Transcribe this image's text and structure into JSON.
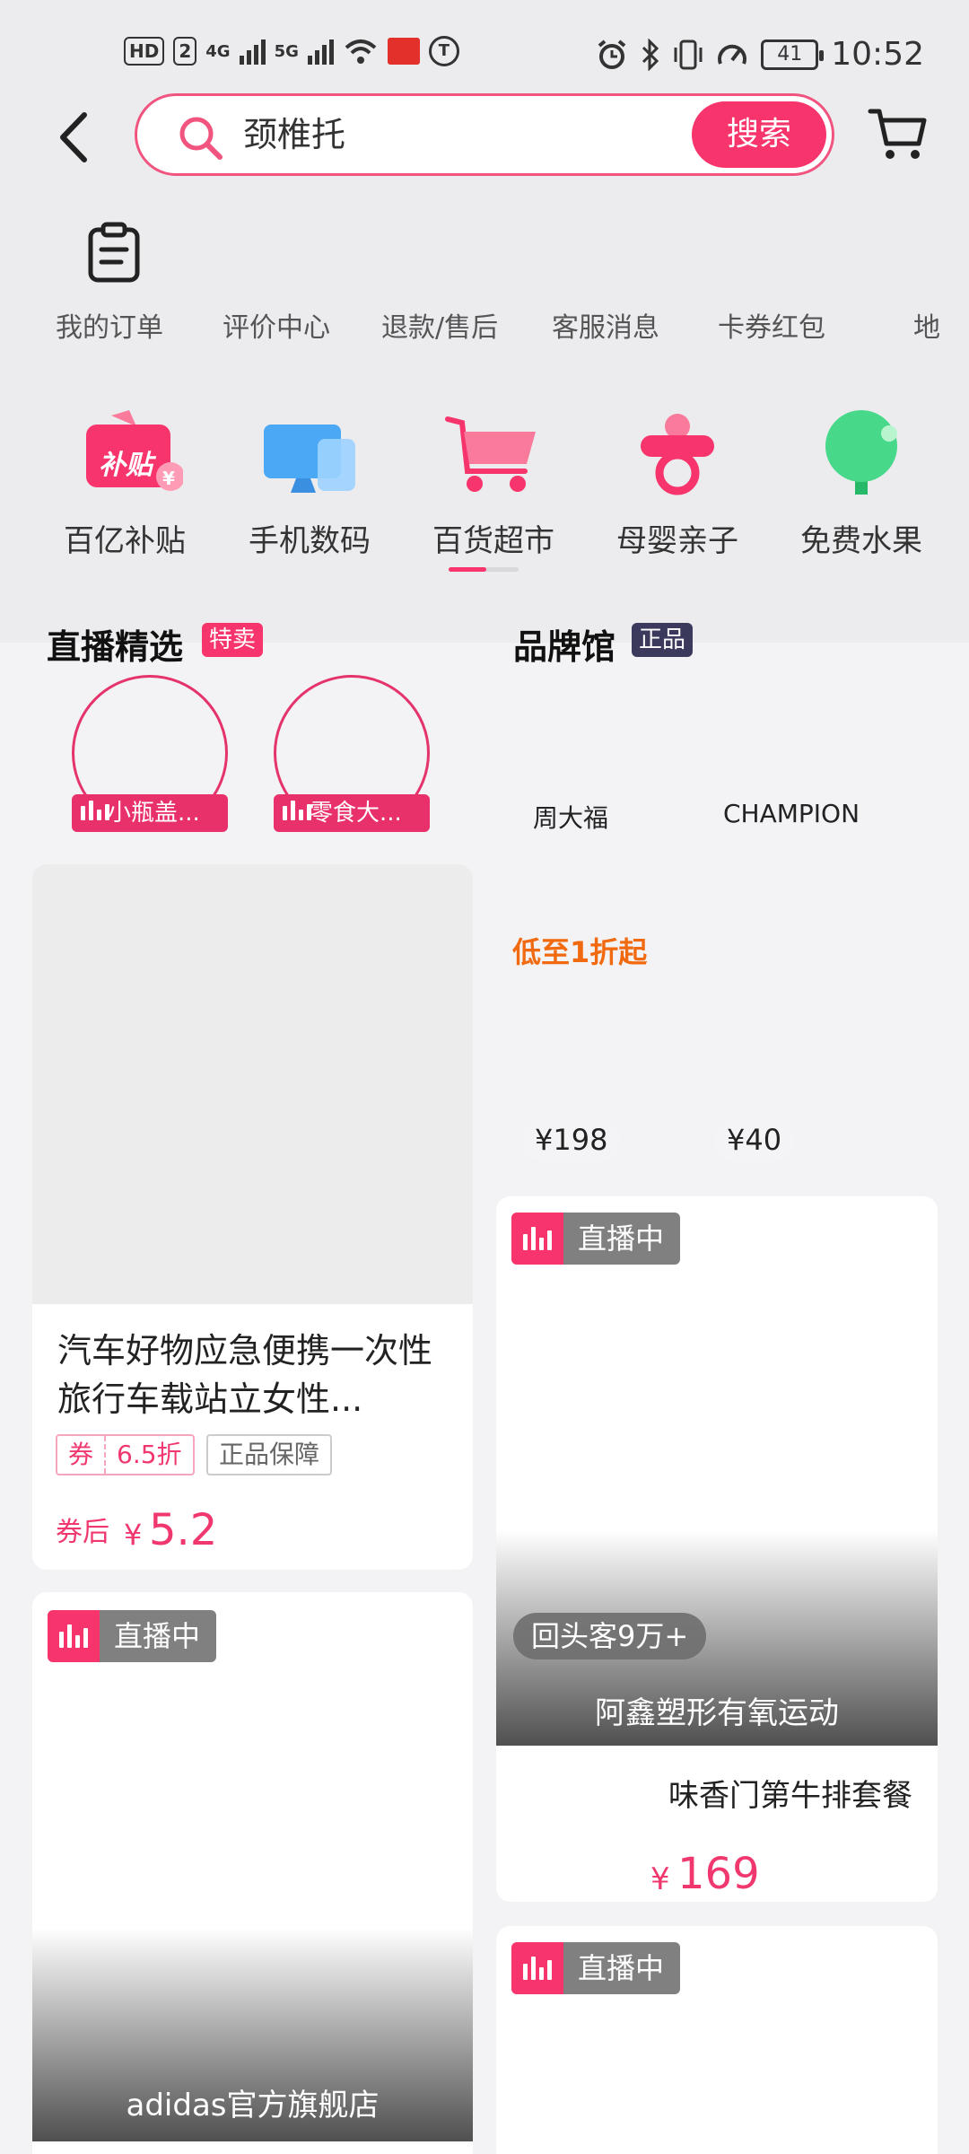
{
  "status_bar": {
    "hd_badge": "HD",
    "sim_badge": "2",
    "net1": "4G",
    "net2": "5G",
    "t_icon": "T",
    "battery": "41",
    "time": "10:52"
  },
  "search": {
    "query": "颈椎托",
    "button_label": "搜索"
  },
  "shortcuts": [
    "我的订单",
    "评价中心",
    "退款/售后",
    "客服消息",
    "卡券红包",
    "地"
  ],
  "categories": [
    "百亿补贴",
    "手机数码",
    "百货超市",
    "母婴亲子",
    "免费水果"
  ],
  "subsidy_icon_text": "补贴",
  "subsidy_icon_currency": "¥",
  "live_section": {
    "title": "直播精选",
    "badge": "特卖",
    "streams": [
      "小瓶盖...",
      "零食大..."
    ]
  },
  "brand_section": {
    "title": "品牌馆",
    "badge": "正品",
    "brands": [
      "周大福",
      "CHAMPION"
    ],
    "promo": "低至1折起",
    "prices": [
      "¥198",
      "¥40"
    ]
  },
  "product_card_1": {
    "title": "汽车好物应急便携一次性旅行车载站立女性...",
    "coupon_label": "券",
    "coupon_value": "6.5折",
    "authentic_tag": "正品保障",
    "price_prefix": "券后",
    "currency": "¥",
    "price": "5.2"
  },
  "live_card_right": {
    "live_label": "直播中",
    "returning": "回头客9万+",
    "streamer": "阿鑫塑形有氧运动",
    "product": "味香门第牛排套餐",
    "currency": "¥",
    "price": "169"
  },
  "live_card_left": {
    "live_label": "直播中",
    "streamer": "adidas官方旗舰店"
  },
  "live_card_right2": {
    "live_label": "直播中"
  },
  "colors": {
    "accent": "#f7346b",
    "promo_orange": "#f26a10",
    "brand_badge": "#3b3a5c"
  }
}
